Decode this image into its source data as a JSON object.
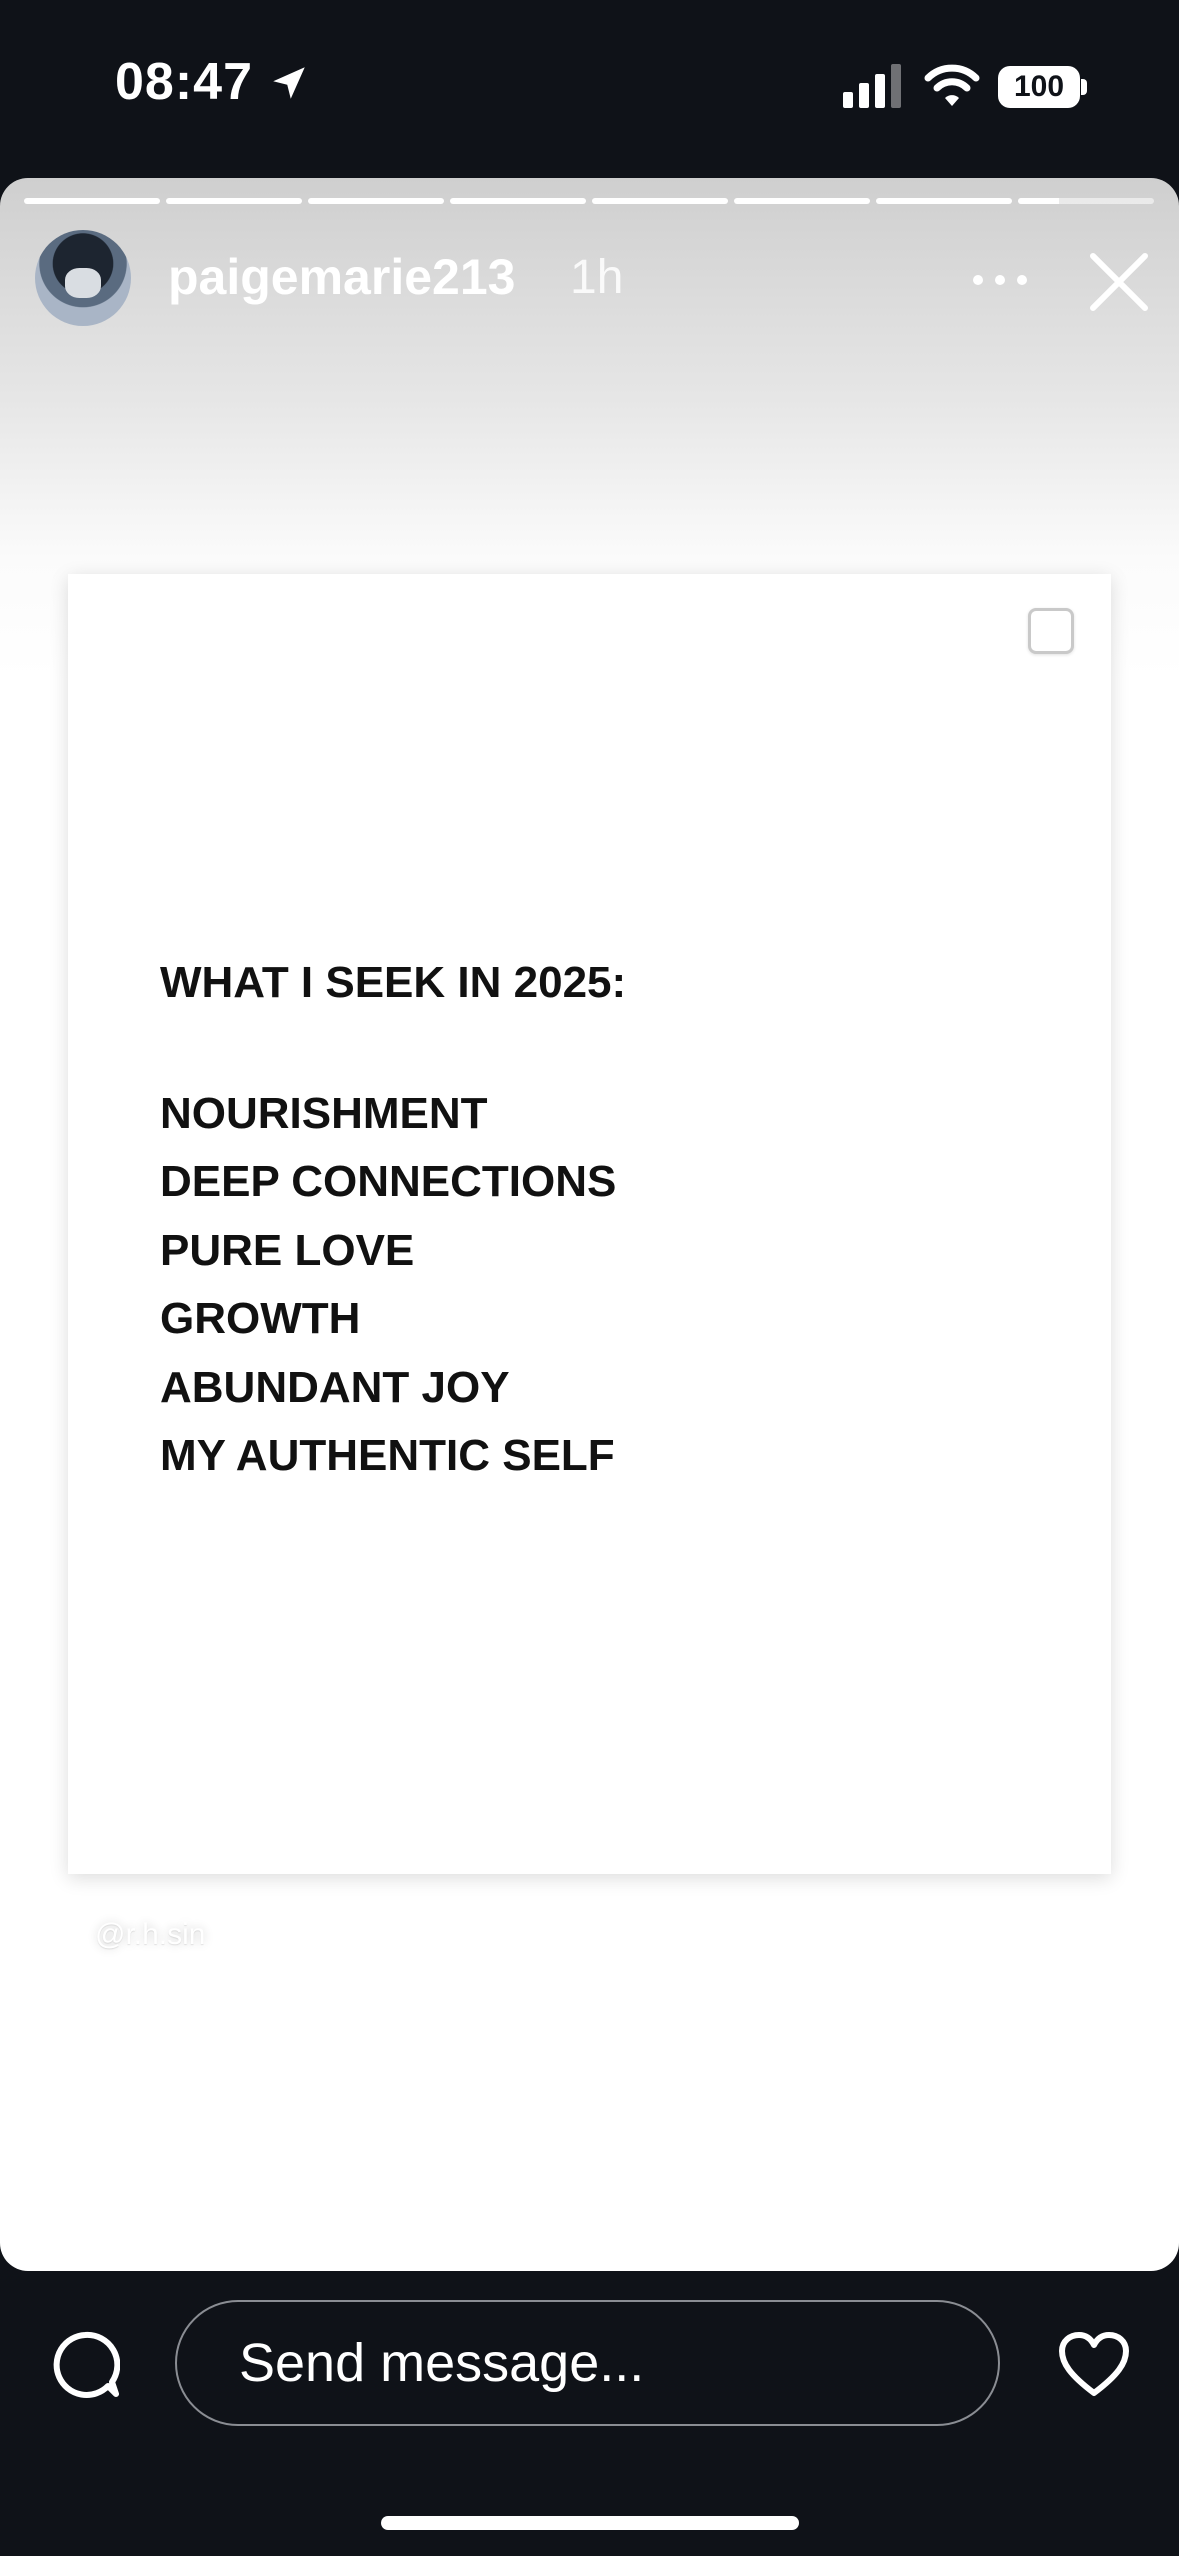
{
  "status_bar": {
    "time": "08:47",
    "battery": "100",
    "icons": [
      "location-arrow-icon",
      "cellular-signal-icon",
      "wifi-icon",
      "battery-icon"
    ]
  },
  "story": {
    "username": "paigemarie213",
    "time_ago": "1h",
    "progress_segments": [
      1,
      1,
      1,
      1,
      1,
      1,
      1,
      0.3
    ],
    "post": {
      "title": "WHAT I SEEK IN 2025:",
      "items": [
        "NOURISHMENT",
        "DEEP CONNECTIONS",
        "PURE LOVE",
        "GROWTH",
        "ABUNDANT JOY",
        "MY AUTHENTIC SELF"
      ],
      "credit": "@r.h.sin"
    }
  },
  "bottom_bar": {
    "message_placeholder": "Send message...",
    "icons": [
      "chat-bubble-icon",
      "heart-icon"
    ]
  },
  "colors": {
    "background": "#0f1218",
    "text_light": "#ffffff",
    "quote_text": "#111111"
  }
}
